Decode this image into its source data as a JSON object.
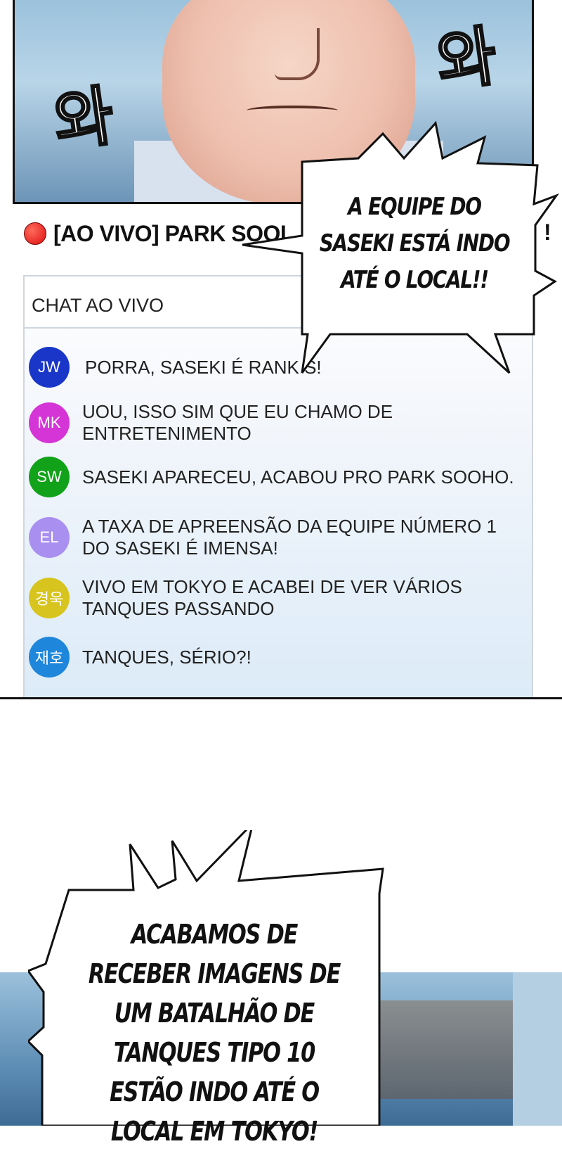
{
  "sfx": {
    "left": "와",
    "right": "와"
  },
  "livestream": {
    "title": "[AO VIVO] PARK SOOI",
    "title_tail": "!",
    "chat_header": "CHAT AO VIVO",
    "messages": [
      {
        "avatar": "JW",
        "color": "#1936c9",
        "text": "PORRA, SASEKI É RANK S!"
      },
      {
        "avatar": "MK",
        "color": "#d534d6",
        "text": "UOU, ISSO SIM QUE EU CHAMO DE ENTRETENIMENTO"
      },
      {
        "avatar": "SW",
        "color": "#11a21a",
        "text": "SASEKI APARECEU, ACABOU PRO PARK SOOHO."
      },
      {
        "avatar": "EL",
        "color": "#a98ff0",
        "text": "A TAXA DE APREENSÃO DA EQUIPE NÚMERO 1 DO SASEKI É IMENSA!"
      },
      {
        "avatar": "경욱",
        "color": "#d8c41e",
        "text": "VIVO EM TOKYO E ACABEI DE VER VÁRIOS TANQUES PASSANDO"
      },
      {
        "avatar": "재호",
        "color": "#1f87db",
        "text": "TANQUES, SÉRIO?!"
      }
    ]
  },
  "bubbles": {
    "first": "A EQUIPE DO SASEKI ESTÁ INDO ATÉ O LOCAL!!",
    "second": "ACABAMOS DE RECEBER IMAGENS DE UM BATALHÃO DE TANQUES TIPO 10 ESTÃO INDO ATÉ O LOCAL EM TOKYO!"
  }
}
